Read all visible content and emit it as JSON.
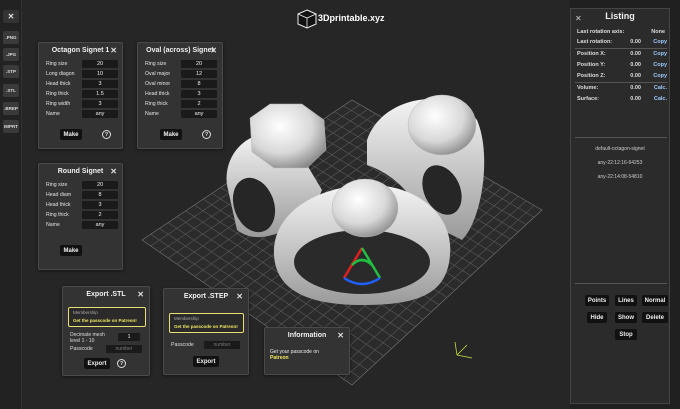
{
  "app": {
    "title": "3Dprintable.xyz"
  },
  "left_bar": {
    "close_label": "✕",
    "buttons": [
      ".PNG",
      ".JPG",
      ".STP",
      ".STL",
      ".BREP",
      "IMPRT"
    ]
  },
  "octagon_panel": {
    "title": "Octagon Signet 1",
    "rows": [
      {
        "label": "Ring size",
        "value": "20"
      },
      {
        "label": "Long diagon",
        "value": "10"
      },
      {
        "label": "Head thick",
        "value": "3"
      },
      {
        "label": "Ring thick",
        "value": "1.5"
      },
      {
        "label": "Ring width",
        "value": "3"
      },
      {
        "label": "Name",
        "value": "any"
      }
    ],
    "make_label": "Make",
    "help_label": "?"
  },
  "oval_panel": {
    "title": "Oval (across) Signet",
    "rows": [
      {
        "label": "Ring size",
        "value": "20"
      },
      {
        "label": "Oval major",
        "value": "12"
      },
      {
        "label": "Oval minor",
        "value": "8"
      },
      {
        "label": "Head thick",
        "value": "3"
      },
      {
        "label": "Ring thick",
        "value": "2"
      },
      {
        "label": "Name",
        "value": "any"
      }
    ],
    "make_label": "Make",
    "help_label": "?"
  },
  "round_panel": {
    "title": "Round Signet",
    "rows": [
      {
        "label": "Ring size",
        "value": "20"
      },
      {
        "label": "Head diam",
        "value": "8"
      },
      {
        "label": "Head thick",
        "value": "3"
      },
      {
        "label": "Ring thick",
        "value": "2"
      },
      {
        "label": "Name",
        "value": "any"
      }
    ],
    "make_label": "Make"
  },
  "export_stl": {
    "title": "Export .STL",
    "membership_label": "Membership",
    "membership_text": "Get the passcode on Patreon!",
    "decimate_label": "Decimate mesh level 1 - 10",
    "decimate_value": "1",
    "passcode_label": "Passcode",
    "passcode_placeholder": "number",
    "export_label": "Export",
    "help_label": "?"
  },
  "export_step": {
    "title": "Export .STEP",
    "membership_label": "Membership",
    "membership_text": "Get the passcode on Patreon!",
    "passcode_label": "Passcode",
    "passcode_placeholder": "number",
    "export_label": "Export"
  },
  "info_panel": {
    "title": "Information",
    "text": "Get your passcode on",
    "link": "Patreon"
  },
  "listing": {
    "title": "Listing",
    "close_label": "✕",
    "last_rotation_axis": {
      "label": "Last rotation axis:",
      "value": "None"
    },
    "rows": [
      {
        "label": "Last rotation:",
        "value": "0.00",
        "action": "Copy"
      },
      {
        "label": "Position X:",
        "value": "0.00",
        "action": "Copy"
      },
      {
        "label": "Position Y:",
        "value": "0.00",
        "action": "Copy"
      },
      {
        "label": "Position Z:",
        "value": "0.00",
        "action": "Copy"
      },
      {
        "label": "Volume:",
        "value": "0.00",
        "action": "Calc."
      },
      {
        "label": "Surface:",
        "value": "0.00",
        "action": "Calc."
      }
    ],
    "files": [
      "default-octagon-signet",
      "any-22:12:16-64253",
      "any-22:14:08-54810"
    ],
    "buttons": {
      "points": "Points",
      "lines": "Lines",
      "normal": "Normal",
      "hide": "Hide",
      "show": "Show",
      "delete": "Delete",
      "stop": "Stop"
    }
  },
  "colors": {
    "accent_yellow": "#f0e860",
    "link_blue": "#9ecbff",
    "axis_red": "#e02020",
    "axis_green": "#20c040",
    "axis_blue": "#2060ff"
  }
}
